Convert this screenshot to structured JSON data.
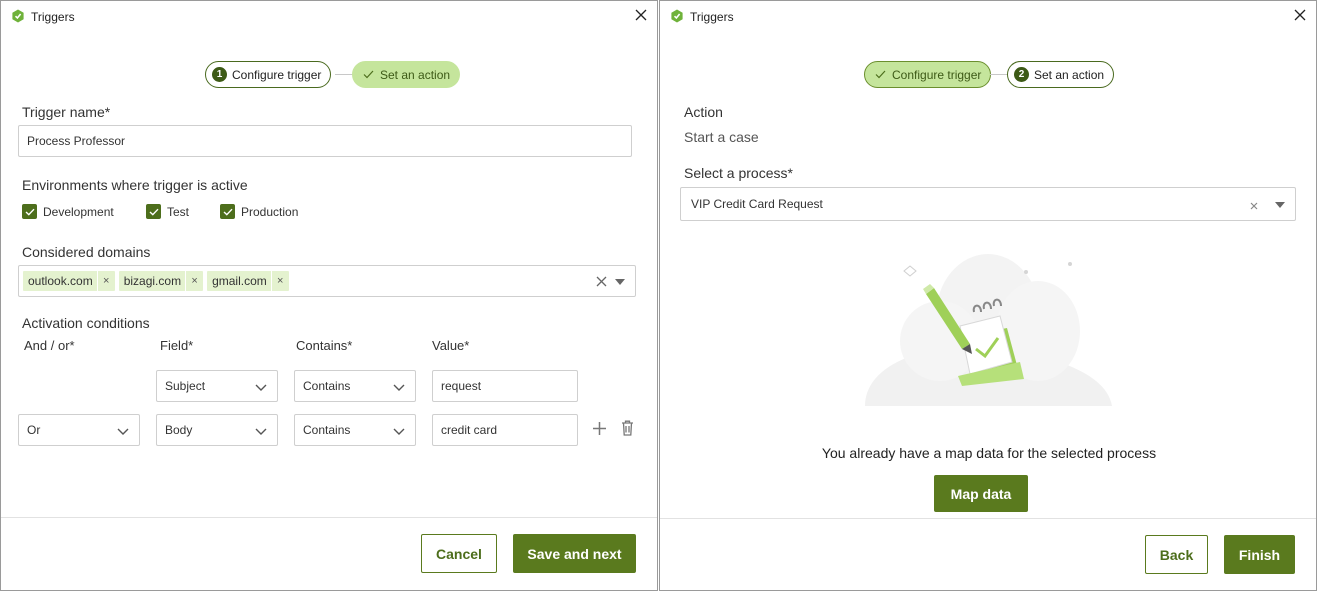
{
  "left": {
    "title": "Triggers",
    "steps": [
      {
        "number": "1",
        "label": "Configure trigger"
      },
      {
        "label": "Set an action"
      }
    ],
    "trigger_name_label": "Trigger name*",
    "trigger_name_value": "Process Professor",
    "environments_label": "Environments where trigger is active",
    "environments": [
      {
        "label": "Development",
        "checked": true
      },
      {
        "label": "Test",
        "checked": true
      },
      {
        "label": "Production",
        "checked": true
      }
    ],
    "domains_label": "Considered domains",
    "domains": [
      "outlook.com",
      "bizagi.com",
      "gmail.com"
    ],
    "activation_label": "Activation conditions",
    "columns": [
      "And / or*",
      "Field*",
      "Contains*",
      "Value*"
    ],
    "rows": [
      {
        "andor": "",
        "field": "Subject",
        "operator": "Contains",
        "value": "request"
      },
      {
        "andor": "Or",
        "field": "Body",
        "operator": "Contains",
        "value": "credit card"
      }
    ],
    "cancel_label": "Cancel",
    "next_label": "Save and next"
  },
  "right": {
    "title": "Triggers",
    "steps": [
      {
        "label": "Configure trigger"
      },
      {
        "number": "2",
        "label": "Set an action"
      }
    ],
    "action_label": "Action",
    "action_value": "Start a case",
    "process_label": "Select a process*",
    "process_value": "VIP Credit Card Request",
    "message": "You already have a map data for the selected process",
    "map_button": "Map data",
    "back_label": "Back",
    "finish_label": "Finish"
  },
  "colors": {
    "primary": "#5a7a1e",
    "accent_light": "#c5e59c",
    "tag_bg": "#e4f2cf"
  }
}
